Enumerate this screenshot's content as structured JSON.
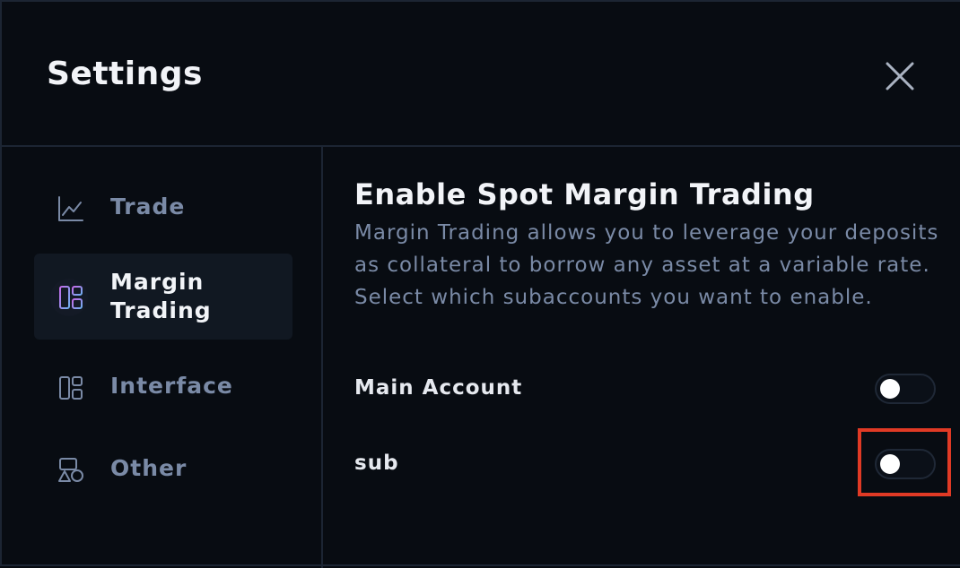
{
  "dialog": {
    "title": "Settings"
  },
  "sidebar": {
    "items": [
      {
        "label": "Trade",
        "icon": "chart-line-icon",
        "active": false
      },
      {
        "label": "Margin\nTrading",
        "label_line1": "Margin",
        "label_line2": "Trading",
        "icon": "layout-grid-icon",
        "active": true
      },
      {
        "label": "Interface",
        "icon": "layout-icon",
        "active": false
      },
      {
        "label": "Other",
        "icon": "shapes-icon",
        "active": false
      }
    ]
  },
  "content": {
    "title": "Enable Spot Margin Trading",
    "description": "Margin Trading allows you to leverage your deposits as collateral to borrow any asset at a variable rate. Select which subaccounts you want to enable.",
    "accounts": [
      {
        "label": "Main Account",
        "enabled": false
      },
      {
        "label": "sub",
        "enabled": false
      }
    ]
  },
  "colors": {
    "background": "#080c12",
    "border": "#1c2533",
    "text_primary": "#f2f4f8",
    "text_muted": "#7a8aa6",
    "highlight": "#e03a25"
  }
}
